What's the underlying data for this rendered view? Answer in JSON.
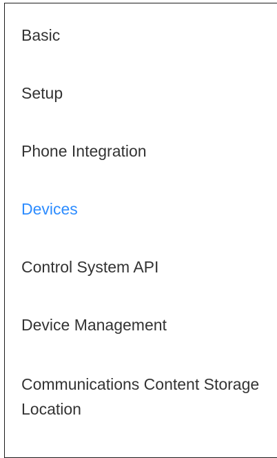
{
  "settings_nav": {
    "items": [
      {
        "label": "Basic"
      },
      {
        "label": "Setup"
      },
      {
        "label": "Phone Integration"
      },
      {
        "label": "Devices",
        "active": true
      },
      {
        "label": "Control System API"
      },
      {
        "label": "Device Management"
      },
      {
        "label": "Communications Content Storage Location"
      }
    ],
    "active_color": "#2d8cff",
    "text_color": "#333333"
  }
}
